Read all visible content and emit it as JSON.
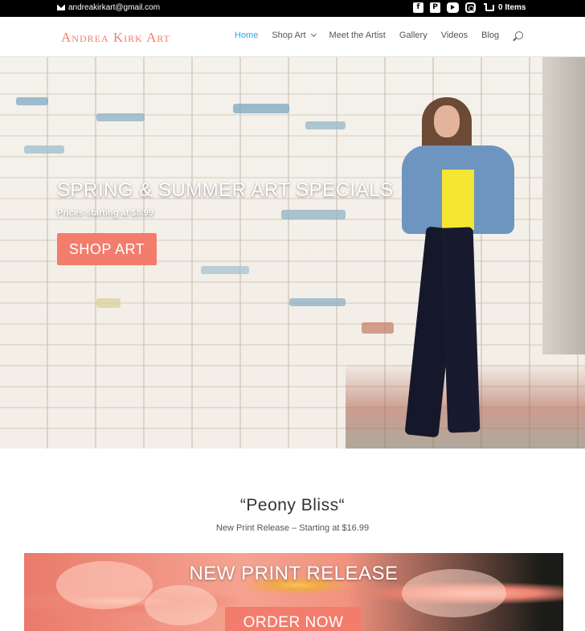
{
  "topbar": {
    "email": "andreakirkart@gmail.com",
    "social_icons": [
      "facebook-icon",
      "pinterest-icon",
      "youtube-icon",
      "instagram-icon"
    ],
    "cart_label": "0 Items"
  },
  "header": {
    "logo": "Andrea Kirk Art",
    "nav": {
      "home": "Home",
      "shop_art": "Shop Art",
      "meet_artist": "Meet the Artist",
      "gallery": "Gallery",
      "videos": "Videos",
      "blog": "Blog"
    }
  },
  "hero": {
    "title": "SPRING & SUMMER ART SPECIALS",
    "subtitle": "Prices starting at $8.99",
    "button": "SHOP ART"
  },
  "feature": {
    "title": "“Peony Bliss“",
    "subtitle": "New Print Release – Starting at $16.99"
  },
  "banner": {
    "title": "NEW PRINT RELEASE",
    "button": "ORDER NOW"
  },
  "colors": {
    "accent": "#f27d6c",
    "nav_active": "#2ea3f2",
    "topbar": "#000000"
  }
}
